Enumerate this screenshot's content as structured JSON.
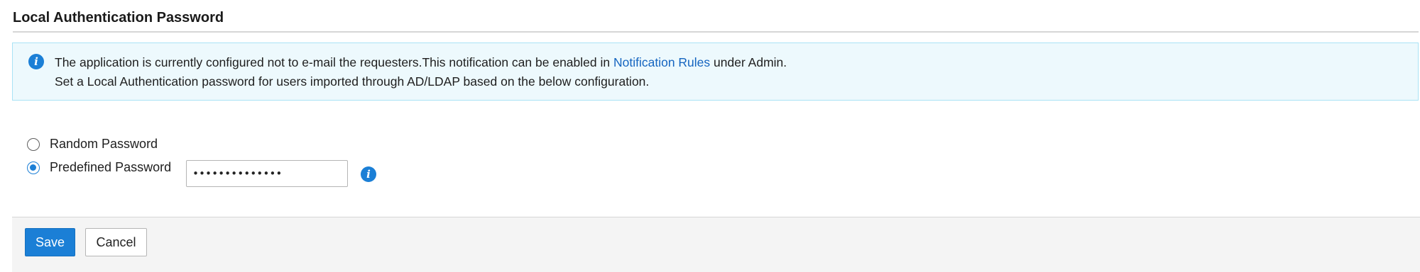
{
  "page": {
    "title": "Local Authentication Password"
  },
  "info_banner": {
    "icon": "info-icon",
    "line1_prefix": "The application is currently configured not to e-mail the requesters.This notification can be enabled in ",
    "line1_link": "Notification Rules",
    "line1_suffix": " under Admin.",
    "line2": "Set a Local Authentication password for users imported through AD/LDAP based on the below configuration."
  },
  "password_options": {
    "random": {
      "label": "Random Password",
      "selected": false
    },
    "predefined": {
      "label": "Predefined Password",
      "selected": true,
      "value": "••••••••••••••",
      "info_icon": "info-icon"
    }
  },
  "actions": {
    "save_label": "Save",
    "cancel_label": "Cancel"
  },
  "colors": {
    "accent": "#1b7fd6",
    "link": "#1565c0",
    "banner_background": "#edf9fd",
    "banner_border": "#a9e3f5",
    "footer_background": "#f4f4f4"
  }
}
